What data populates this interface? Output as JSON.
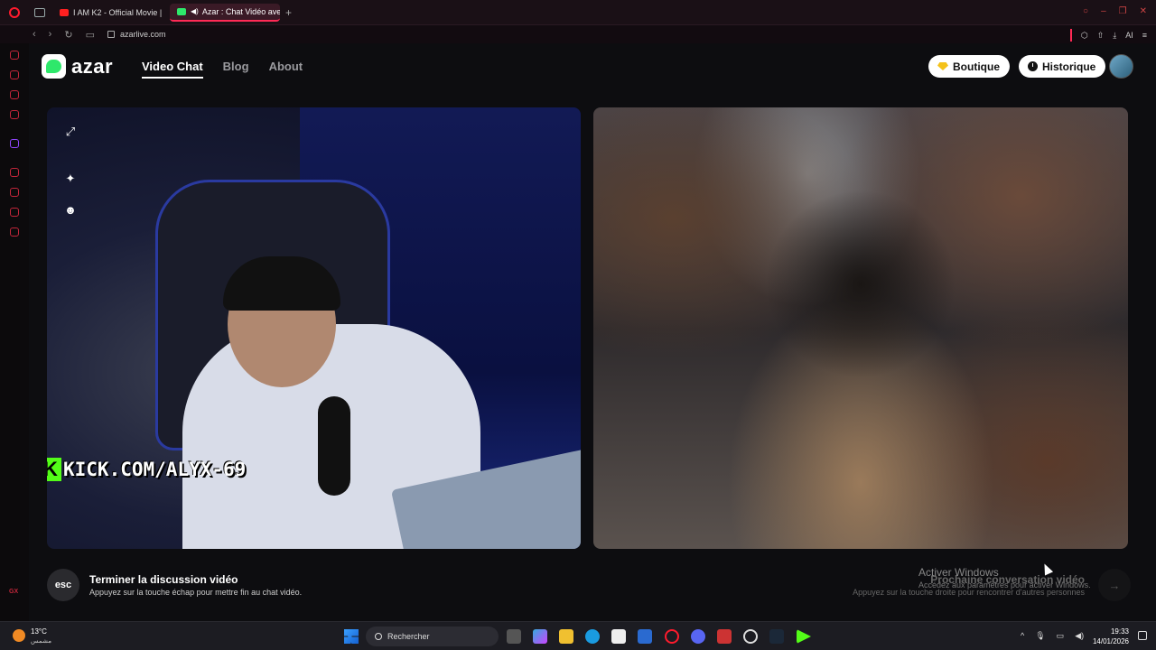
{
  "browser": {
    "tabs": [
      {
        "label": "I AM K2 - Official Movie | ."
      },
      {
        "label": "Azar : Chat Vidéo avec"
      }
    ],
    "url": "azarlive.com",
    "ai_label": "AI"
  },
  "site": {
    "logo_text": "azar",
    "nav": [
      "Video Chat",
      "Blog",
      "About"
    ],
    "shop_label": "Boutique",
    "history_label": "Historique"
  },
  "video": {
    "overlay_text": "KICK.COM/ALYX-69"
  },
  "footer": {
    "esc_key": "esc",
    "end_title": "Terminer la discussion vidéo",
    "end_sub": "Appuyez sur la touche échap pour mettre fin au chat vidéo.",
    "next_title": "Prochaine conversation vidéo",
    "next_sub": "Appuyez sur la touche droite pour rencontrer d'autres personnes",
    "activate_title": "Activer Windows",
    "activate_sub": "Accédez aux paramètres pour activer Windows."
  },
  "taskbar": {
    "weather_temp": "13°C",
    "weather_sub": "مشمس",
    "search_label": "Rechercher",
    "time": "19:33",
    "date": "14/01/2026"
  },
  "colors": {
    "opera_red": "#ff1b2d",
    "azar_green": "#2ee86b",
    "kick_green": "#53fc18"
  }
}
